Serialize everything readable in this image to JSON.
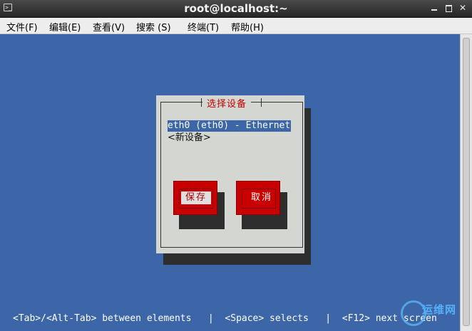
{
  "window": {
    "title": "root@localhost:~"
  },
  "menu": {
    "file": "文件(F)",
    "edit": "编辑(E)",
    "view": "查看(V)",
    "search": "搜索 (S)",
    "terminal": "终端(T)",
    "help": "帮助(H)"
  },
  "dialog": {
    "title": "选择设备",
    "devices": [
      "eth0 (eth0) - Ethernet",
      "<新设备>"
    ],
    "save_label": "保存",
    "cancel_label": "取消"
  },
  "status": {
    "text": "<Tab>/<Alt-Tab> between elements   |  <Space> selects   |  <F12> next screen"
  },
  "watermark": {
    "text": "运维网"
  }
}
